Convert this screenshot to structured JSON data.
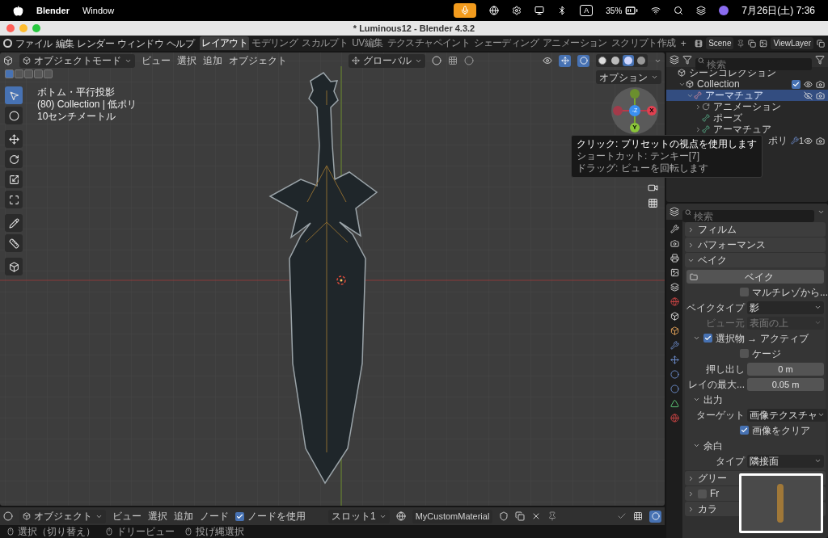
{
  "menubar": {
    "app": "Blender",
    "menus": [
      "Window"
    ],
    "input_source": "A",
    "battery": "35%",
    "datetime": "7月26日(土) 7:36"
  },
  "window": {
    "title": "* Luminous12 - Blender 4.3.2"
  },
  "topbar": {
    "menus": [
      "ファイル",
      "編集",
      "レンダー",
      "ウィンドウ",
      "ヘルプ"
    ],
    "workspaces": [
      {
        "label": "レイアウト",
        "selected": true
      },
      {
        "label": "モデリング",
        "selected": false
      },
      {
        "label": "スカルプト",
        "selected": false
      },
      {
        "label": "UV編集",
        "selected": false
      },
      {
        "label": "テクスチャペイント",
        "selected": false
      },
      {
        "label": "シェーディング",
        "selected": false
      },
      {
        "label": "アニメーション",
        "selected": false
      },
      {
        "label": "スクリプト作成",
        "selected": false
      }
    ],
    "add_workspace": "+",
    "scene": "Scene",
    "view_layer": "ViewLayer"
  },
  "viewport": {
    "mode": "オブジェクトモード",
    "menus": [
      "ビュー",
      "選択",
      "追加",
      "オブジェクト"
    ],
    "orientation": "グローバル",
    "shading_modes": [
      {
        "selected": false
      },
      {
        "selected": false
      },
      {
        "selected": true
      },
      {
        "selected": false
      }
    ],
    "select_modes": [
      {
        "selected": true
      },
      {
        "selected": false
      },
      {
        "selected": false
      },
      {
        "selected": false
      },
      {
        "selected": false
      }
    ],
    "options": "オプション",
    "info": [
      "ボトム・平行投影",
      "(80) Collection | 低ポリ",
      "10センチメートル"
    ],
    "tools": [
      {
        "selected": true
      },
      {
        "selected": false
      },
      {
        "selected": false
      },
      {
        "selected": false
      },
      {
        "selected": false
      },
      {
        "selected": false
      },
      {
        "selected": false
      },
      {
        "selected": false
      },
      {
        "selected": false
      }
    ],
    "gizmo": {
      "x": "X",
      "y": "Y",
      "z": "-Z"
    },
    "tooltip": {
      "title": "クリック: プリセットの視点を使用します",
      "lines": [
        "ショートカット: テンキー[7]",
        "ドラッグ: ビューを回転します"
      ]
    }
  },
  "outliner": {
    "search_placeholder": "検索",
    "tree": [
      {
        "label": "シーンコレクション",
        "kind": "scene",
        "selected": false,
        "children": [
          {
            "label": "Collection",
            "kind": "collection",
            "expanded": true,
            "selected": false,
            "included": true,
            "visible": true,
            "children": [
              {
                "label": "アーマチュア",
                "kind": "armature",
                "expanded": true,
                "selected": true,
                "visible": false,
                "children": [
                  {
                    "label": "アニメーション",
                    "kind": "action",
                    "expanded": false,
                    "selected": false
                  },
                  {
                    "label": "ポーズ",
                    "kind": "pose",
                    "selected": false
                  },
                  {
                    "label": "アーマチュア",
                    "kind": "armature_data",
                    "expanded": false,
                    "selected": false
                  }
                ]
              },
              {
                "label": "ポリ",
                "kind": "mesh",
                "selected": false,
                "visible": true,
                "count": "1"
              }
            ]
          }
        ]
      }
    ]
  },
  "properties": {
    "search_placeholder": "検索",
    "panels": [
      {
        "title": "フィルム",
        "expanded": false
      },
      {
        "title": "パフォーマンス",
        "expanded": false
      },
      {
        "title": "ベイク",
        "expanded": true,
        "rows": [
          {
            "kind": "button",
            "label": "ベイク"
          },
          {
            "kind": "checkbox",
            "label": "マルチレゾから...",
            "checked": false
          },
          {
            "kind": "select",
            "label": "ベイクタイプ",
            "value": "影",
            "disabled": false
          },
          {
            "kind": "select",
            "label": "ビュー元",
            "value": "表面の上",
            "disabled": true
          },
          {
            "kind": "subpanel",
            "label": "選択物 → アクティブ",
            "expanded": true,
            "checked": true
          },
          {
            "kind": "checkbox",
            "label": "ケージ",
            "checked": false
          },
          {
            "kind": "number",
            "label": "押し出し",
            "value": "0 m"
          },
          {
            "kind": "number",
            "label": "レイの最大...",
            "value": "0.05 m"
          },
          {
            "kind": "subpanel",
            "label": "出力",
            "expanded": true
          },
          {
            "kind": "select",
            "label": "ターゲット",
            "value": "画像テクスチャ",
            "disabled": false
          },
          {
            "kind": "checkbox",
            "label": "画像をクリア",
            "checked": true
          },
          {
            "kind": "subpanel",
            "label": "余白",
            "expanded": true
          },
          {
            "kind": "select",
            "label": "タイプ",
            "value": "隣接面",
            "disabled": false
          }
        ]
      },
      {
        "title": "グリー",
        "expanded": false
      },
      {
        "title": "Fr",
        "expanded": false,
        "checked": false
      },
      {
        "title": "カラ",
        "expanded": false
      }
    ]
  },
  "node_header": {
    "editor": "オブジェクト",
    "menus": [
      "ビュー",
      "選択",
      "追加",
      "ノード"
    ],
    "use_nodes": {
      "label": "ノードを使用",
      "checked": true
    },
    "slot": "スロット1",
    "material": "MyCustomMaterial"
  },
  "status_bar": [
    "選択（切り替え）",
    "ドリービュー",
    "投げ縄選択"
  ]
}
